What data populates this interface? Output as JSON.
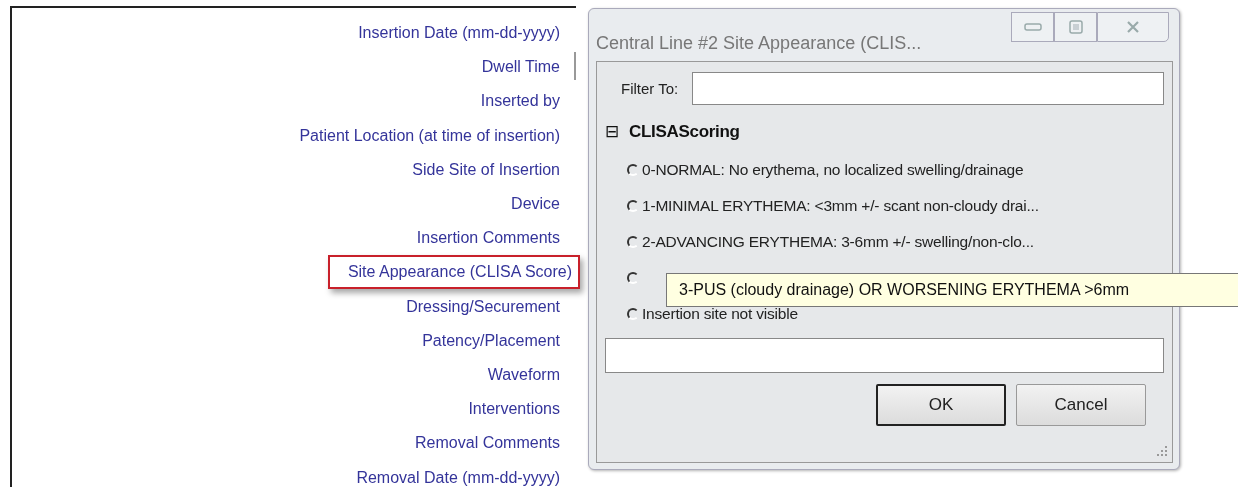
{
  "fields": [
    {
      "label": "Insertion Date (mm-dd-yyyy)",
      "highlighted": false
    },
    {
      "label": "Dwell Time",
      "highlighted": false
    },
    {
      "label": "Inserted by",
      "highlighted": false
    },
    {
      "label": "Patient Location (at time of insertion)",
      "highlighted": false
    },
    {
      "label": "Side Site of Insertion",
      "highlighted": false
    },
    {
      "label": "Device",
      "highlighted": false
    },
    {
      "label": "Insertion Comments",
      "highlighted": false
    },
    {
      "label": "Site Appearance (CLISA Score)",
      "highlighted": true
    },
    {
      "label": "Dressing/Securement",
      "highlighted": false
    },
    {
      "label": "Patency/Placement",
      "highlighted": false
    },
    {
      "label": "Waveform",
      "highlighted": false
    },
    {
      "label": "Interventions",
      "highlighted": false
    },
    {
      "label": "Removal Comments",
      "highlighted": false
    },
    {
      "label": "Removal Date (mm-dd-yyyy)",
      "highlighted": false
    }
  ],
  "dialog": {
    "title": "Central Line #2 Site Appearance (CLIS...",
    "filter": {
      "label": "Filter To:"
    },
    "group": {
      "toggle": "⊟",
      "title": "CLISAScoring",
      "expanded": true,
      "options": [
        {
          "label": "0-NORMAL: No erythema, no localized swelling/drainage",
          "selected": false
        },
        {
          "label": "1-MINIMAL ERYTHEMA: <3mm +/-  scant non-cloudy drai...",
          "selected": false
        },
        {
          "label": "2-ADVANCING ERYTHEMA: 3-6mm +/- swelling/non-clo...",
          "selected": false
        },
        {
          "selected": false
        },
        {
          "label": "Insertion site not visible",
          "selected": false
        }
      ]
    },
    "tooltip": "3-PUS (cloudy drainage) OR WORSENING ERYTHEMA >6mm",
    "buttons": [
      {
        "label": "OK",
        "default": true
      },
      {
        "label": "Cancel",
        "default": false
      }
    ]
  }
}
